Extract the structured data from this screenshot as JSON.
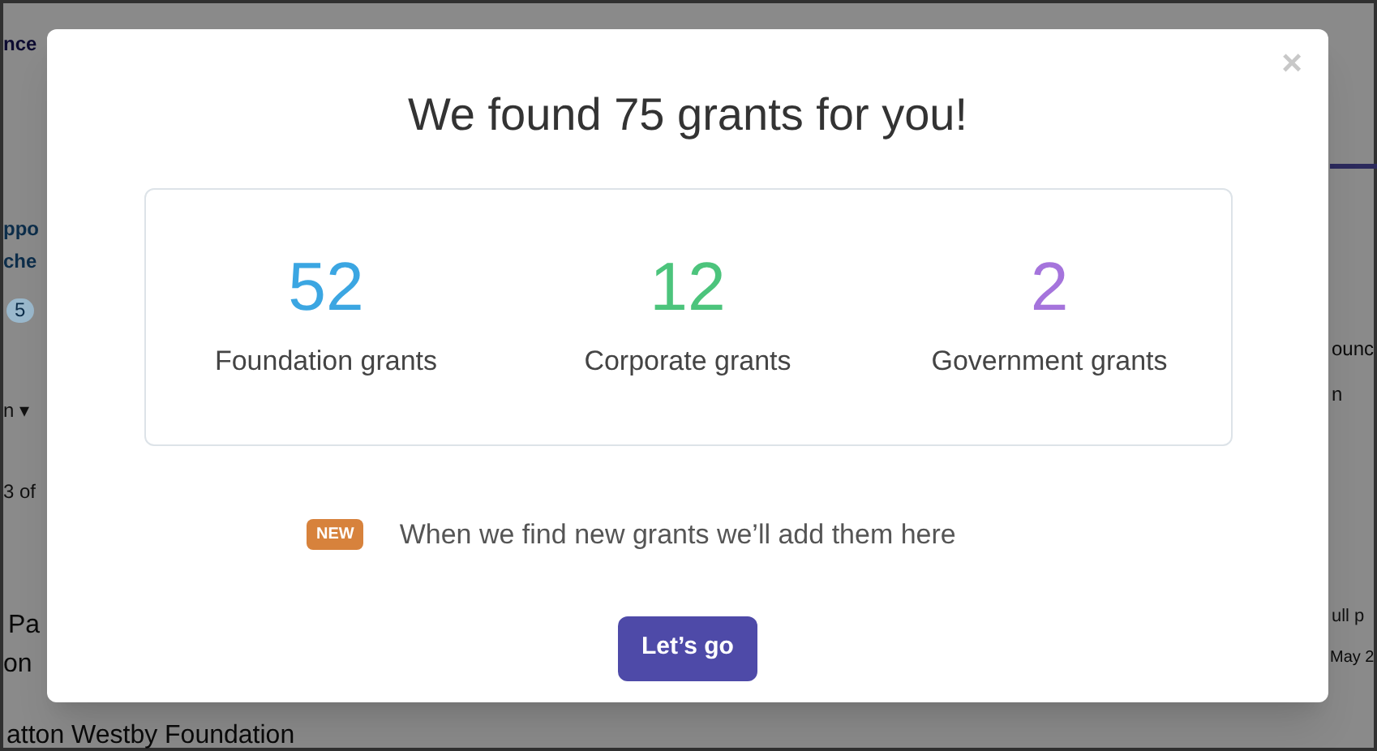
{
  "background": {
    "texts": [
      {
        "kind": "heading",
        "text": "nce"
      },
      {
        "kind": "link",
        "text": "ppo"
      },
      {
        "kind": "link",
        "text": "che"
      },
      {
        "kind": "count",
        "text": "5"
      },
      {
        "kind": "muted",
        "text": "n ▾"
      },
      {
        "kind": "muted",
        "text": "3 of"
      },
      {
        "kind": "body",
        "text": "Pa"
      },
      {
        "kind": "body",
        "text": "on"
      },
      {
        "kind": "body",
        "text": "atton Westby Foundation"
      },
      {
        "kind": "body",
        "text": "ounc"
      },
      {
        "kind": "muted",
        "text": "n"
      },
      {
        "kind": "muted",
        "text": "ull p"
      },
      {
        "kind": "body",
        "text": "May 2"
      }
    ]
  },
  "modal": {
    "close": "×",
    "title": "We found 75 grants for you!",
    "stats": [
      {
        "value": "52",
        "label": "Foundation grants",
        "color": "#3ba6e2"
      },
      {
        "value": "12",
        "label": "Corporate grants",
        "color": "#4cc47c"
      },
      {
        "value": "2",
        "label": "Government grants",
        "color": "#a574dc"
      }
    ],
    "notice": {
      "badge": "NEW",
      "text": "When we find new grants we’ll add them here"
    },
    "button": "Let’s go"
  }
}
